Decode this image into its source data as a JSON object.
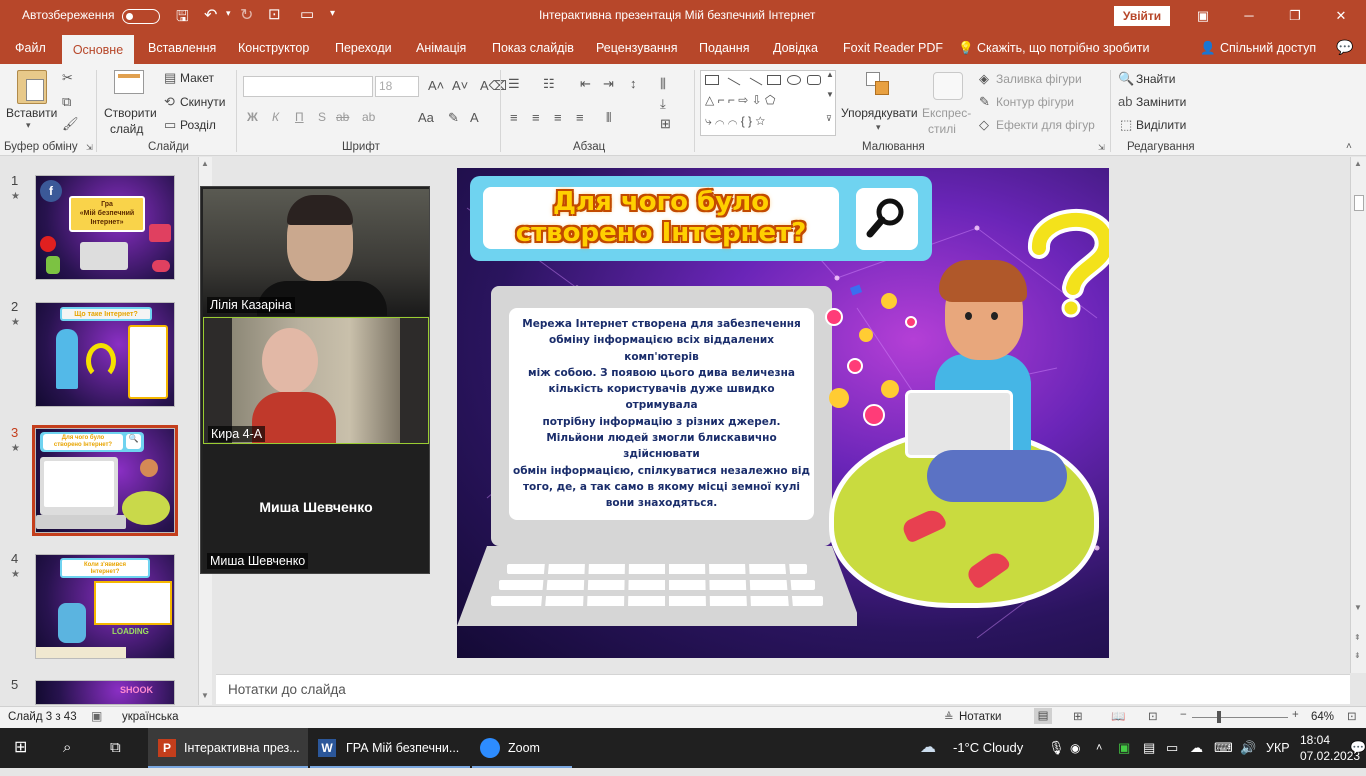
{
  "titlebar": {
    "autosave_label": "Автозбереження",
    "autosave_state": "off",
    "title": "Інтерактивна презентація Мій безпечний Інтернет",
    "signin_label": "Увійти",
    "accent": "#b7472a"
  },
  "tabs": [
    "Файл",
    "Основне",
    "Вставлення",
    "Конструктор",
    "Переходи",
    "Анімація",
    "Показ слайдів",
    "Рецензування",
    "Подання",
    "Довідка",
    "Foxit Reader PDF",
    "Скажіть, що потрібно зробити",
    "Спільний доступ"
  ],
  "ribbon": {
    "clipboard": {
      "paste": "Вставити",
      "label": "Буфер обміну"
    },
    "slides": {
      "new_slide_1": "Створити",
      "new_slide_2": "слайд",
      "layout": "Макет",
      "reset": "Скинути",
      "section": "Розділ",
      "label": "Слайди"
    },
    "font": {
      "size": "18",
      "bold": "Ж",
      "italic": "К",
      "underline": "П",
      "strike": "S",
      "spacing": "ab",
      "label": "Шрифт"
    },
    "paragraph": {
      "label": "Абзац"
    },
    "drawing": {
      "arrange": "Упорядкувати",
      "quick_styles_1": "Експрес-",
      "quick_styles_2": "стилі",
      "fill": "Заливка фігури",
      "outline": "Контур фігури",
      "effects": "Ефекти для фігур",
      "label": "Малювання"
    },
    "editing": {
      "find": "Знайти",
      "replace": "Замінити",
      "select": "Виділити",
      "label": "Редагування"
    }
  },
  "thumbnails": [
    {
      "num": "1",
      "title_1": "Гра",
      "title_2": "«Мій безпечний",
      "title_3": "Інтернет»"
    },
    {
      "num": "2",
      "title": "Що таке Інтернет?"
    },
    {
      "num": "3",
      "title_1": "Для чого було",
      "title_2": "створено Інтернет?"
    },
    {
      "num": "4",
      "title_1": "Коли з'явився",
      "title_2": "Інтернет?",
      "loading": "LOADING"
    },
    {
      "num": "5",
      "shook": "SHOOK"
    }
  ],
  "zoom": {
    "participants": [
      {
        "name": "Лілія Казаріна"
      },
      {
        "name": "Кира 4-А"
      },
      {
        "name": "Миша Шевченко",
        "center_name": "Миша Шевченко"
      }
    ]
  },
  "slide": {
    "title_1": "Для чого було",
    "title_2": "створено Інтернет?",
    "body_lines": [
      "Мережа Інтернет створена для забезпечення",
      "обміну інформацією всіх віддалених комп'ютерів",
      "між собою. З появою цього дива  величезна",
      "кількість користувачів  дуже швидко отримувала",
      "потрібну інформацію з різних  джерел.",
      "Мільйони людей змогли блискавично здійснювати",
      "обмін інформацією, спілкуватися незалежно від",
      "того, де, а так само в якому місці земної кулі",
      "вони знаходяться."
    ]
  },
  "notes": {
    "placeholder": "Нотатки до слайда"
  },
  "status": {
    "slide_counter": "Слайд 3 з 43",
    "language": "українська",
    "notes_button": "Нотатки",
    "zoom_level": "64%"
  },
  "taskbar": {
    "apps": [
      {
        "label": "Інтерактивна през..."
      },
      {
        "label": "ГРА Мій безпечни..."
      },
      {
        "label": "Zoom"
      }
    ],
    "weather": "-1°C  Cloudy",
    "lang": "УКР",
    "time": "18:04",
    "date": "07.02.2023"
  }
}
